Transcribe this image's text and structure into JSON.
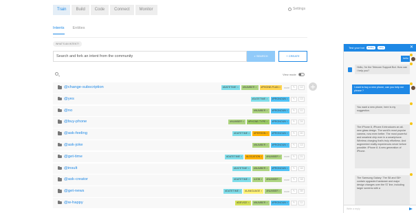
{
  "topnav": {
    "tabs": [
      {
        "label": "Train",
        "active": true
      },
      {
        "label": "Build",
        "active": false
      },
      {
        "label": "Code",
        "active": false
      },
      {
        "label": "Connect",
        "active": false
      },
      {
        "label": "Monitor",
        "active": false
      }
    ],
    "settings_label": "Settings"
  },
  "subnav": {
    "tabs": [
      {
        "label": "Intents",
        "active": true
      },
      {
        "label": "Entities",
        "active": false
      }
    ]
  },
  "whats_intent_label": "WHAT'S AN INTENT?",
  "search": {
    "placeholder": "Search and fork an intent from the community",
    "button_label": "SEARCH",
    "create_label": "CREATE"
  },
  "view_mode_label": "View mode",
  "colors": {
    "accent": "#1e88e5",
    "datetime": "#80deea",
    "number": "#aed581",
    "phone_purple": "#ffd54f",
    "pronoun": "#4fc3f7",
    "location": "#ffb300",
    "language": "#fff176",
    "device": "#d4e157"
  },
  "intents": [
    {
      "name": "@change-subscription",
      "entities": [
        {
          "label": "#DATETIME",
          "color": "#80deea"
        },
        {
          "label": "#NUMBER",
          "color": "#aed581"
        },
        {
          "label": "#PHONE-PLAN",
          "color": "#ffd54f"
        }
      ],
      "more": "more",
      "count": "12"
    },
    {
      "name": "@yes",
      "entities": [
        {
          "label": "#DATETIME",
          "color": "#80deea"
        },
        {
          "label": "#PRONOUN",
          "color": "#4fc3f7"
        }
      ],
      "more": "",
      "count": "13"
    },
    {
      "name": "@no",
      "entities": [
        {
          "label": "#NUMBER",
          "color": "#aed581"
        },
        {
          "label": "#PRONOUN",
          "color": "#4fc3f7"
        }
      ],
      "more": "",
      "count": "11"
    },
    {
      "name": "@buy-phone",
      "entities": [
        {
          "label": "#NUMBER",
          "color": "#aed581"
        },
        {
          "label": "#PHONE-TYPE",
          "color": "#9ccc65"
        },
        {
          "label": "#PRONOUN",
          "color": "#4fc3f7"
        }
      ],
      "more": "",
      "count": "24"
    },
    {
      "name": "@ask-feeling",
      "entities": [
        {
          "label": "#DATETIME",
          "color": "#80deea"
        },
        {
          "label": "#PERSON",
          "color": "#ffb300"
        },
        {
          "label": "#PRONOUN",
          "color": "#4fc3f7"
        }
      ],
      "more": "",
      "count": "20"
    },
    {
      "name": "@ask-joke",
      "entities": [
        {
          "label": "#NUMBER",
          "color": "#aed581"
        },
        {
          "label": "#PRONOUN",
          "color": "#4fc3f7"
        }
      ],
      "more": "",
      "count": "13"
    },
    {
      "name": "@get-time",
      "entities": [
        {
          "label": "#DATETIME",
          "color": "#80deea"
        },
        {
          "label": "#LOCATION",
          "color": "#ffb300"
        },
        {
          "label": "#NUMBER",
          "color": "#aed581"
        }
      ],
      "more": "more",
      "count": "21"
    },
    {
      "name": "@insult",
      "entities": [
        {
          "label": "#DATETIME",
          "color": "#80deea"
        },
        {
          "label": "#NUMBER",
          "color": "#aed581"
        },
        {
          "label": "#PRONOUN",
          "color": "#4fc3f7"
        }
      ],
      "more": "",
      "count": "16"
    },
    {
      "name": "@ask-creator",
      "entities": [
        {
          "label": "#DATETIME",
          "color": "#80deea"
        },
        {
          "label": "#JOB",
          "color": "#aed581"
        },
        {
          "label": "#NUMBER",
          "color": "#aed581"
        }
      ],
      "more": "more",
      "count": "18"
    },
    {
      "name": "@get-news",
      "entities": [
        {
          "label": "#DATETIME",
          "color": "#80deea"
        },
        {
          "label": "#LANGUAGE",
          "color": "#fff176"
        },
        {
          "label": "#NUMBER",
          "color": "#aed581"
        }
      ],
      "more": "more",
      "count": "39"
    },
    {
      "name": "@w-happy",
      "entities": [
        {
          "label": "#DEVICE",
          "color": "#d4e157"
        },
        {
          "label": "#NUMBER",
          "color": "#aed581"
        },
        {
          "label": "#PRONOUN",
          "color": "#4fc3f7"
        }
      ],
      "more": "",
      "count": "11"
    }
  ],
  "bot": {
    "title": "Test your bot",
    "debug_pill": "Debug",
    "lang_pill": "Lang",
    "messages": [
      {
        "from": "user",
        "text": "hello"
      },
      {
        "from": "bot",
        "text": "Hello, I'm the Telecom Support Bot. How can I help you?"
      },
      {
        "from": "user",
        "text": "I want to buy a new phone, can you help me please ?"
      },
      {
        "from": "bot",
        "text": "You want a new phone, here is my suggestion."
      },
      {
        "from": "bot",
        "text": "The iPhone 8, iPhone 8 introduces an all-new glass design. The world's most popular camera, now even better. The most powerful and smartest chip ever in a smartphone. Wireless charging that's truly effortless. And augmented reality experiences never before possible. iPhone 8. A new generation of iPhone."
      },
      {
        "from": "bot",
        "text": "The Samsung Galaxy: The S8 and S8+ contain upgraded hardware and major design changes over the S7 line, including larger screens with a"
      }
    ],
    "input_placeholder": "Write a reply"
  }
}
